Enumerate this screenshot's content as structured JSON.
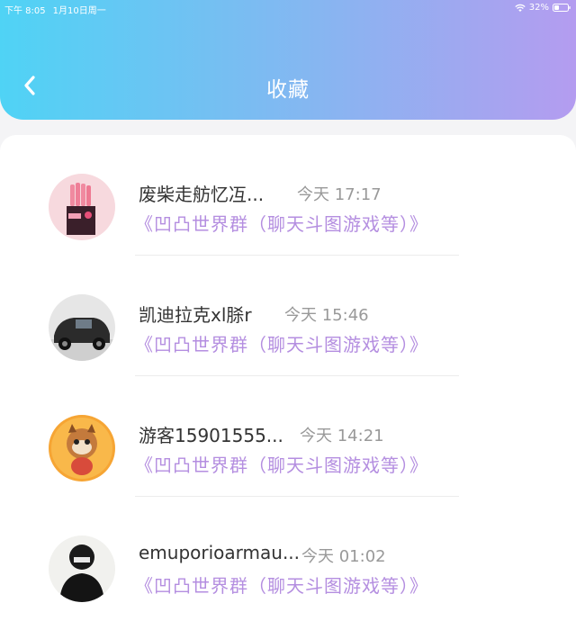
{
  "status": {
    "time": "下午 8:05",
    "date": "1月10日周一",
    "battery": "32%"
  },
  "header": {
    "title": "收藏",
    "back_icon": "chevron-left-icon"
  },
  "colors": {
    "gradient_start": "#4fd3f5",
    "gradient_end": "#b49cf0",
    "link": "#b48ee0"
  },
  "favorites": [
    {
      "name": "废柴走舫忆冱...",
      "time": "今天 17:17",
      "group": "《凹凸世界群（聊天斗图游戏等）》"
    },
    {
      "name": "凯迪拉克xl脎r",
      "time": "今天 15:46",
      "group": "《凹凸世界群（聊天斗图游戏等）》"
    },
    {
      "name": "游客15901555...",
      "time": "今天 14:21",
      "group": "《凹凸世界群（聊天斗图游戏等）》"
    },
    {
      "name": "emuporioarmau...",
      "time": "今天 01:02",
      "group": "《凹凸世界群（聊天斗图游戏等）》"
    }
  ]
}
